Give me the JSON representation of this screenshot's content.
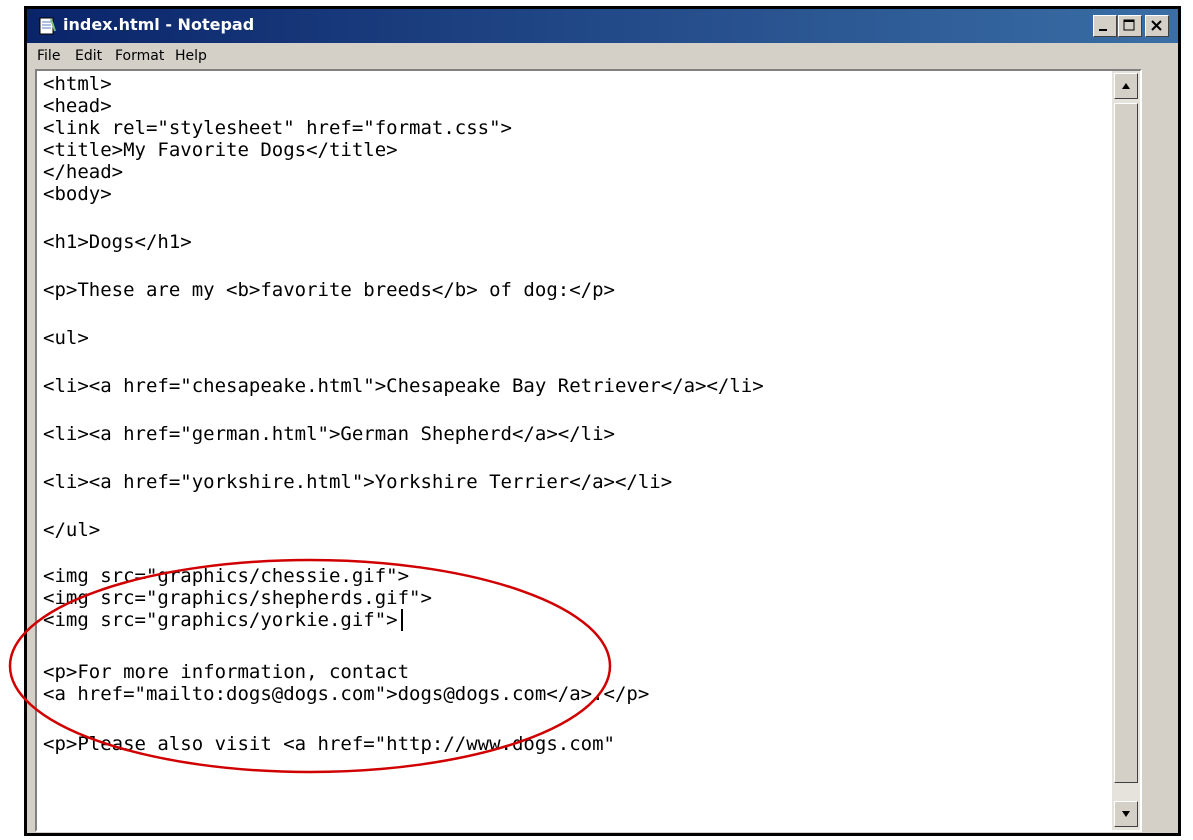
{
  "window": {
    "title": "index.html - Notepad",
    "controls": [
      "minimize",
      "maximize",
      "close"
    ]
  },
  "menu": {
    "items": [
      {
        "label": "File"
      },
      {
        "label": "Edit"
      },
      {
        "label": "Format"
      },
      {
        "label": "Help"
      }
    ]
  },
  "editor": {
    "lines": [
      {
        "text": "<html>"
      },
      {
        "text": "<head>"
      },
      {
        "text": "<link rel=\"stylesheet\" href=\"format.css\">"
      },
      {
        "text": "<title>My Favorite Dogs</title>"
      },
      {
        "text": "</head>"
      },
      {
        "text": "<body>"
      },
      {
        "text": "<h1>Dogs</h1>"
      },
      {
        "text": "<p>These are my <b>favorite breeds</b> of dog:</p>"
      },
      {
        "text": "<ul>"
      },
      {
        "text": "<li><a href=\"chesapeake.html\">Chesapeake Bay Retriever</a></li>"
      },
      {
        "text": "<li><a href=\"german.html\">German Shepherd</a></li>"
      },
      {
        "text": "<li><a href=\"yorkshire.html\">Yorkshire Terrier</a></li>"
      },
      {
        "text": "</ul>"
      },
      {
        "text": "<img src=\"graphics/chessie.gif\">"
      },
      {
        "text": "<img src=\"graphics/shepherds.gif\">"
      },
      {
        "text": "<img src=\"graphics/yorkie.gif\">"
      },
      {
        "text": "<p>For more information, contact"
      },
      {
        "text": "<a href=\"mailto:dogs@dogs.com\">dogs@dogs.com</a>.</p>"
      },
      {
        "text": "<p>Please also visit <a href=\"http://www.dogs.com\""
      }
    ]
  },
  "annotation": {
    "shape": "ellipse",
    "color": "#d10000"
  },
  "colors": {
    "titlebar_start": "#0a246a",
    "titlebar_end": "#3a6ea5",
    "chrome": "#d4d0c8"
  }
}
